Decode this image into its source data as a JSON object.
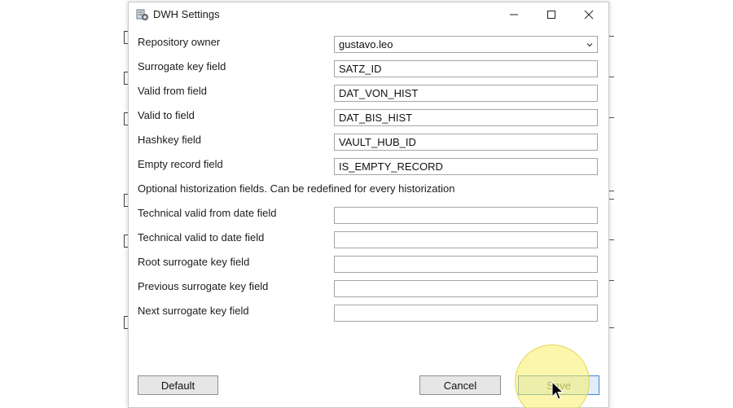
{
  "dialog": {
    "title": "DWH Settings"
  },
  "window_controls": {
    "minimize": "minimize",
    "maximize": "maximize",
    "close": "close"
  },
  "fields": [
    {
      "label": "Repository owner",
      "value": "gustavo.leo",
      "type": "select"
    },
    {
      "label": "Surrogate key field",
      "value": "SATZ_ID",
      "type": "text"
    },
    {
      "label": "Valid from field",
      "value": "DAT_VON_HIST",
      "type": "text"
    },
    {
      "label": "Valid to field",
      "value": "DAT_BIS_HIST",
      "type": "text"
    },
    {
      "label": "Hashkey field",
      "value": "VAULT_HUB_ID",
      "type": "text"
    },
    {
      "label": "Empty record field",
      "value": "IS_EMPTY_RECORD",
      "type": "text"
    }
  ],
  "optional_note": "Optional historization fields. Can be redefined for every historization",
  "optional_fields": [
    {
      "label": "Technical valid from date field",
      "value": ""
    },
    {
      "label": "Technical valid to date field",
      "value": ""
    },
    {
      "label": "Root surrogate key field",
      "value": ""
    },
    {
      "label": "Previous surrogate key field",
      "value": ""
    },
    {
      "label": "Next surrogate key field",
      "value": ""
    }
  ],
  "buttons": {
    "default": "Default",
    "cancel": "Cancel",
    "save": "Save"
  },
  "colors": {
    "accent": "#3c84d8",
    "highlight": "#f7ef66"
  }
}
